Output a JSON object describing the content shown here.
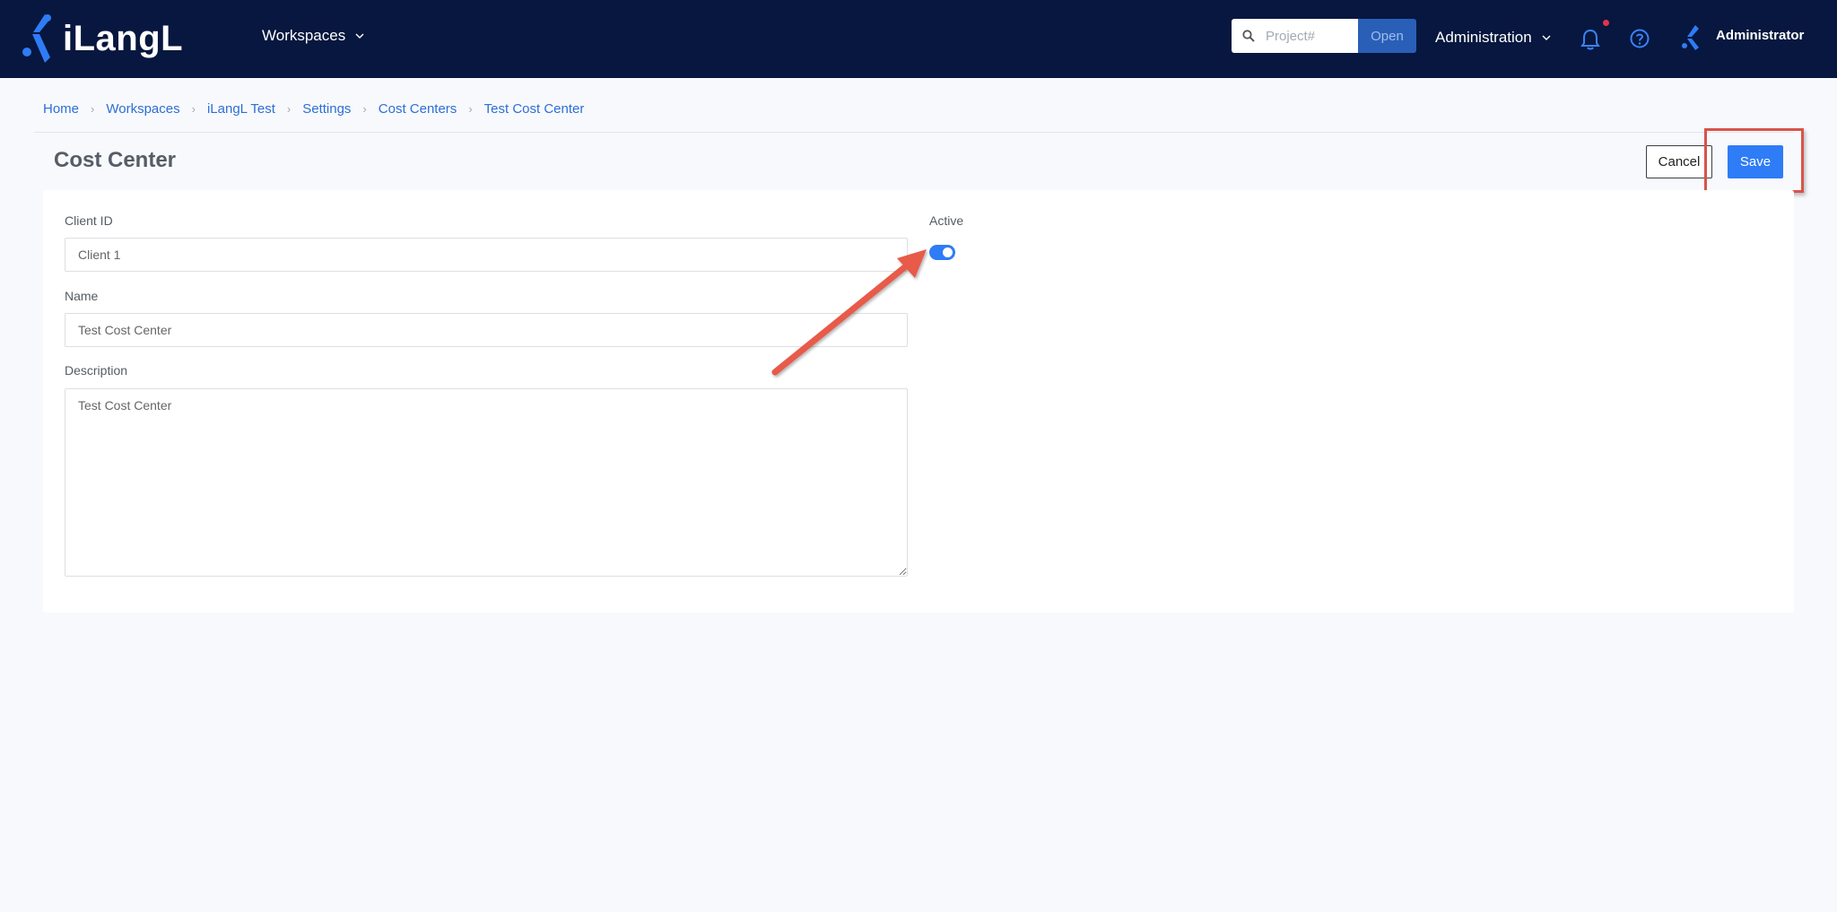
{
  "topbar": {
    "logo_text": "iLangL",
    "workspaces_label": "Workspaces",
    "search_placeholder": "Project#",
    "open_label": "Open",
    "administration_label": "Administration",
    "user_name": "Administrator",
    "icons": {
      "logo": "ilangl-logo-icon",
      "workspaces_chevron": "chevron-down-icon",
      "search": "search-icon",
      "admin_chevron": "chevron-down-icon",
      "notifications": "bell-icon",
      "help": "help-circle-icon",
      "avatar": "user-avatar-icon"
    },
    "notification_dot_color": "#e5334b",
    "bg_color": "#07173f"
  },
  "breadcrumb": {
    "items": [
      "Home",
      "Workspaces",
      "iLangL Test",
      "Settings",
      "Cost Centers",
      "Test Cost Center"
    ],
    "separator_icon": "chevron-right-icon"
  },
  "page": {
    "title": "Cost Center",
    "cancel_label": "Cancel",
    "save_label": "Save"
  },
  "form": {
    "client_id": {
      "label": "Client ID",
      "value": "Client 1"
    },
    "name": {
      "label": "Name",
      "value": "Test Cost Center"
    },
    "description": {
      "label": "Description",
      "value": "Test Cost Center"
    },
    "active": {
      "label": "Active",
      "value": true
    }
  },
  "annotations": {
    "arrow_color": "#e85a4a",
    "highlight_color": "#d9534a"
  },
  "colors": {
    "accent": "#2e7cf6",
    "link": "#2d6fd6"
  }
}
